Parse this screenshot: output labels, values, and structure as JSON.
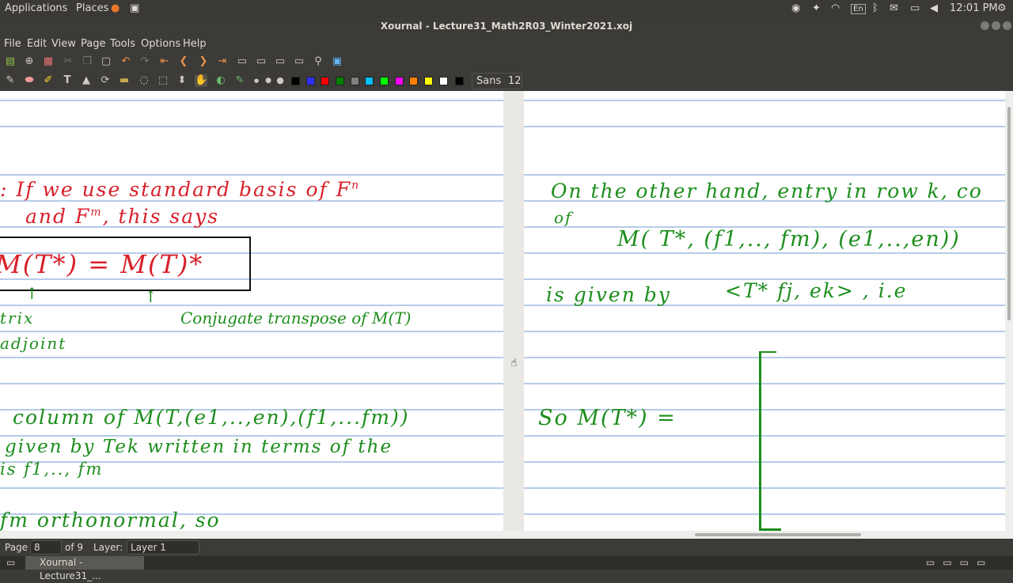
{
  "system_bar": {
    "applications": "Applications",
    "places": "Places",
    "keyboard": "En",
    "clock": "12:01 PM"
  },
  "window": {
    "title": "Xournal - Lecture31_Math2R03_Winter2021.xoj"
  },
  "menu": [
    "File",
    "Edit",
    "View",
    "Page",
    "Tools",
    "Options",
    "Help"
  ],
  "toolbar": {
    "font_name": "Sans",
    "font_size": "12",
    "colors": [
      "#000000",
      "#3030ff",
      "#ff0000",
      "#008000",
      "#808080",
      "#00c0ff",
      "#00ff00",
      "#ff00ff",
      "#ff8000",
      "#ffff00",
      "#ffffff",
      "#000000"
    ]
  },
  "notes": {
    "left_page": {
      "line1": ": If we use standard basis of F",
      "line1_sup": "n",
      "line2": "and F",
      "line2_sup": "m",
      "line2_rest": ", this says",
      "boxed_formula": "M(T*) = M(T)*",
      "label_left1": "trix",
      "label_left2": "adjoint",
      "label_right": "Conjugate transpose of M(T)",
      "line5": "column of M(T,(e1,..,en),(f1,...fm))",
      "line6": "given by  Tek  written in terms of the",
      "line7": "is  f1,.., fm",
      "line8": "fm  orthonormal, so"
    },
    "right_page": {
      "line1": "On the other hand, entry  in row k, co",
      "line2": "of",
      "line3": "M( T*, (f1,.., fm), (e1,..,en))",
      "line4": "is given by",
      "line4_inner": "<T* fj, ek> , i.e",
      "line5": "So  M(T*) ="
    }
  },
  "status": {
    "page_label": "Page",
    "page_value": "8",
    "of_pages": "of 9",
    "layer_label": "Layer:",
    "layer_value": "Layer 1"
  },
  "taskbar": {
    "task_label": "Xournal - Lecture31_..."
  }
}
